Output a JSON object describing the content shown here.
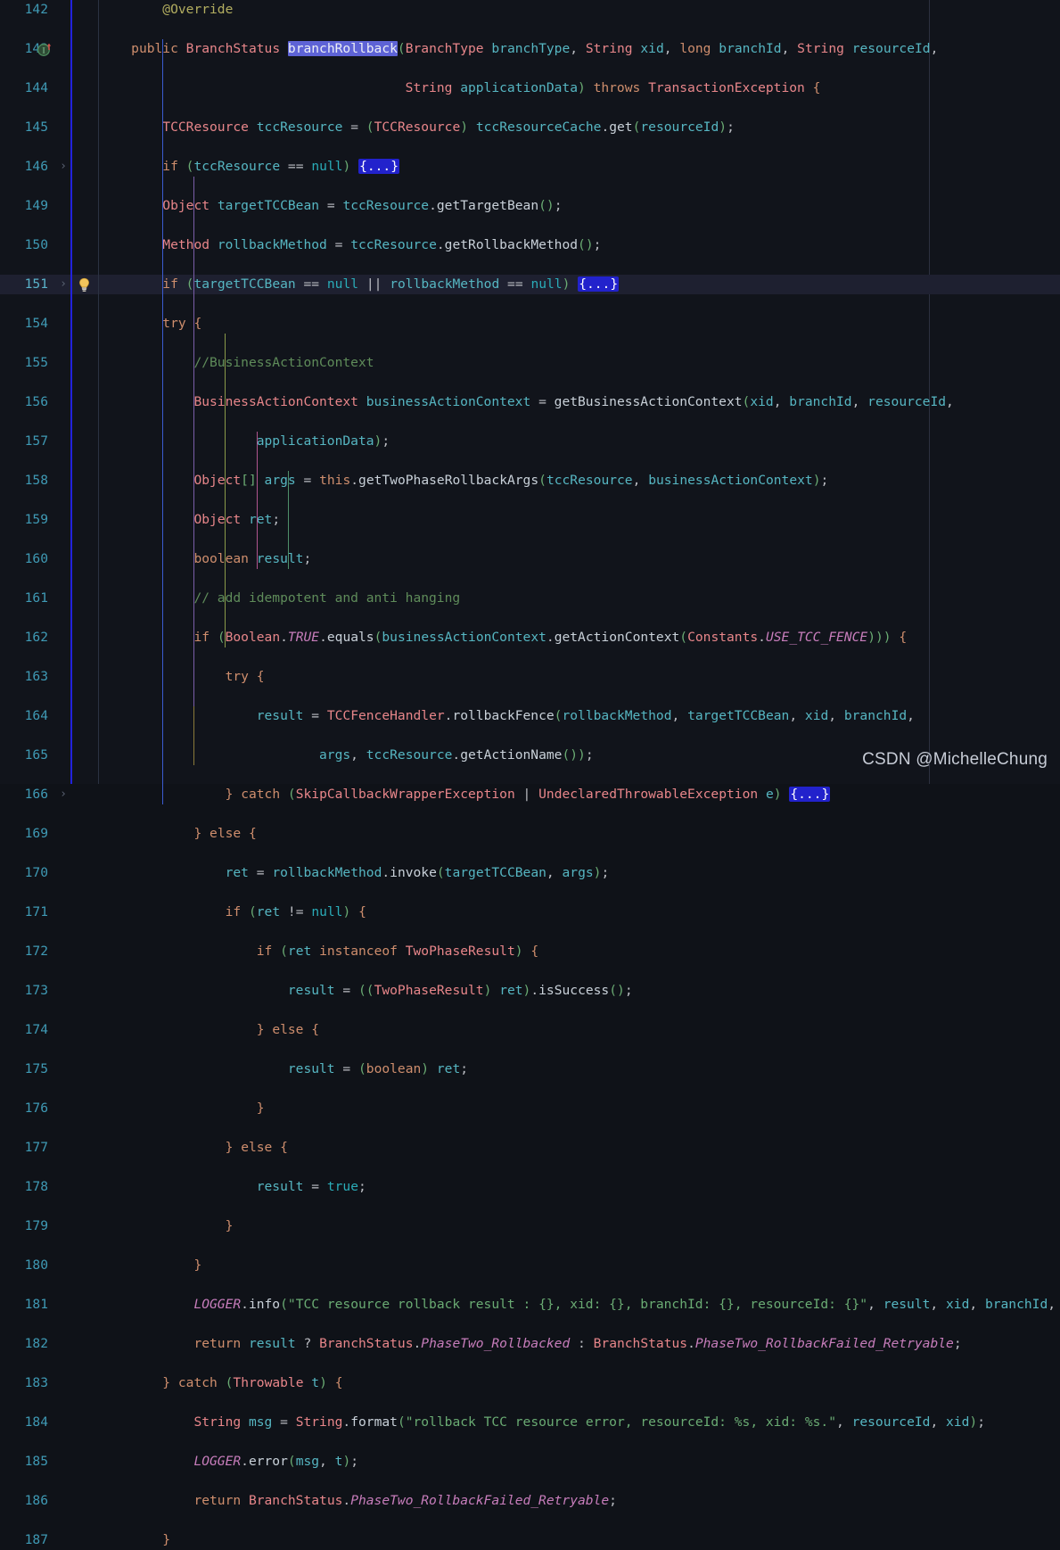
{
  "editor": {
    "theme_background": "#11141b",
    "caret_line_background": "#1e2030",
    "selection_color": "#5e63d6",
    "fold_placeholder_background": "#2222cc",
    "gutter_change_marker_color": "#2222dd",
    "line_number_color": "#3f9ab5",
    "right_margin_ruler_x": 1042,
    "font_size_px": 14.6,
    "line_height_px": 22
  },
  "watermark": {
    "text": "CSDN @MichelleChung"
  },
  "icons": {
    "implementing_method": "implementing-method-icon",
    "intention_bulb": "intention-bulb-icon",
    "fold_arrow": "›",
    "fold_placeholder": "{...}"
  },
  "code": {
    "language": "java",
    "file_kind": "TCCResourceManager.java",
    "lines": [
      {
        "n": "142",
        "fold": false,
        "gutter_icon": null,
        "caret": false,
        "text": "        @Override"
      },
      {
        "n": "143",
        "fold": false,
        "gutter_icon": "implementing-method-icon",
        "caret": false,
        "text": "    public BranchStatus branchRollback(BranchType branchType, String xid, long branchId, String resourceId,"
      },
      {
        "n": "144",
        "fold": false,
        "gutter_icon": null,
        "caret": false,
        "text": "                                       String applicationData) throws TransactionException {"
      },
      {
        "n": "145",
        "fold": false,
        "gutter_icon": null,
        "caret": false,
        "text": "        TCCResource tccResource = (TCCResource) tccResourceCache.get(resourceId);"
      },
      {
        "n": "146",
        "fold": true,
        "gutter_icon": null,
        "caret": false,
        "text": "        if (tccResource == null) {...}"
      },
      {
        "n": "149",
        "fold": false,
        "gutter_icon": null,
        "caret": false,
        "text": "        Object targetTCCBean = tccResource.getTargetBean();"
      },
      {
        "n": "150",
        "fold": false,
        "gutter_icon": null,
        "caret": false,
        "text": "        Method rollbackMethod = tccResource.getRollbackMethod();"
      },
      {
        "n": "151",
        "fold": true,
        "gutter_icon": "intention-bulb-icon",
        "caret": true,
        "text": "        if (targetTCCBean == null || rollbackMethod == null) {...}"
      },
      {
        "n": "154",
        "fold": false,
        "gutter_icon": null,
        "caret": false,
        "text": "        try {"
      },
      {
        "n": "155",
        "fold": false,
        "gutter_icon": null,
        "caret": false,
        "text": "            //BusinessActionContext"
      },
      {
        "n": "156",
        "fold": false,
        "gutter_icon": null,
        "caret": false,
        "text": "            BusinessActionContext businessActionContext = getBusinessActionContext(xid, branchId, resourceId,"
      },
      {
        "n": "157",
        "fold": false,
        "gutter_icon": null,
        "caret": false,
        "text": "                    applicationData);"
      },
      {
        "n": "158",
        "fold": false,
        "gutter_icon": null,
        "caret": false,
        "text": "            Object[] args = this.getTwoPhaseRollbackArgs(tccResource, businessActionContext);"
      },
      {
        "n": "159",
        "fold": false,
        "gutter_icon": null,
        "caret": false,
        "text": "            Object ret;"
      },
      {
        "n": "160",
        "fold": false,
        "gutter_icon": null,
        "caret": false,
        "text": "            boolean result;"
      },
      {
        "n": "161",
        "fold": false,
        "gutter_icon": null,
        "caret": false,
        "text": "            // add idempotent and anti hanging"
      },
      {
        "n": "162",
        "fold": false,
        "gutter_icon": null,
        "caret": false,
        "text": "            if (Boolean.TRUE.equals(businessActionContext.getActionContext(Constants.USE_TCC_FENCE))) {"
      },
      {
        "n": "163",
        "fold": false,
        "gutter_icon": null,
        "caret": false,
        "text": "                try {"
      },
      {
        "n": "164",
        "fold": false,
        "gutter_icon": null,
        "caret": false,
        "text": "                    result = TCCFenceHandler.rollbackFence(rollbackMethod, targetTCCBean, xid, branchId,"
      },
      {
        "n": "165",
        "fold": false,
        "gutter_icon": null,
        "caret": false,
        "text": "                            args, tccResource.getActionName());"
      },
      {
        "n": "166",
        "fold": true,
        "gutter_icon": null,
        "caret": false,
        "text": "                } catch (SkipCallbackWrapperException | UndeclaredThrowableException e) {...}"
      },
      {
        "n": "169",
        "fold": false,
        "gutter_icon": null,
        "caret": false,
        "text": "            } else {"
      },
      {
        "n": "170",
        "fold": false,
        "gutter_icon": null,
        "caret": false,
        "text": "                ret = rollbackMethod.invoke(targetTCCBean, args);"
      },
      {
        "n": "171",
        "fold": false,
        "gutter_icon": null,
        "caret": false,
        "text": "                if (ret != null) {"
      },
      {
        "n": "172",
        "fold": false,
        "gutter_icon": null,
        "caret": false,
        "text": "                    if (ret instanceof TwoPhaseResult) {"
      },
      {
        "n": "173",
        "fold": false,
        "gutter_icon": null,
        "caret": false,
        "text": "                        result = ((TwoPhaseResult) ret).isSuccess();"
      },
      {
        "n": "174",
        "fold": false,
        "gutter_icon": null,
        "caret": false,
        "text": "                    } else {"
      },
      {
        "n": "175",
        "fold": false,
        "gutter_icon": null,
        "caret": false,
        "text": "                        result = (boolean) ret;"
      },
      {
        "n": "176",
        "fold": false,
        "gutter_icon": null,
        "caret": false,
        "text": "                    }"
      },
      {
        "n": "177",
        "fold": false,
        "gutter_icon": null,
        "caret": false,
        "text": "                } else {"
      },
      {
        "n": "178",
        "fold": false,
        "gutter_icon": null,
        "caret": false,
        "text": "                    result = true;"
      },
      {
        "n": "179",
        "fold": false,
        "gutter_icon": null,
        "caret": false,
        "text": "                }"
      },
      {
        "n": "180",
        "fold": false,
        "gutter_icon": null,
        "caret": false,
        "text": "            }"
      },
      {
        "n": "181",
        "fold": false,
        "gutter_icon": null,
        "caret": false,
        "text": "            LOGGER.info(\"TCC resource rollback result : {}, xid: {}, branchId: {}, resourceId: {}\", result, xid, branchId, resourceId);"
      },
      {
        "n": "182",
        "fold": false,
        "gutter_icon": null,
        "caret": false,
        "text": "            return result ? BranchStatus.PhaseTwo_Rollbacked : BranchStatus.PhaseTwo_RollbackFailed_Retryable;"
      },
      {
        "n": "183",
        "fold": false,
        "gutter_icon": null,
        "caret": false,
        "text": "        } catch (Throwable t) {"
      },
      {
        "n": "184",
        "fold": false,
        "gutter_icon": null,
        "caret": false,
        "text": "            String msg = String.format(\"rollback TCC resource error, resourceId: %s, xid: %s.\", resourceId, xid);"
      },
      {
        "n": "185",
        "fold": false,
        "gutter_icon": null,
        "caret": false,
        "text": "            LOGGER.error(msg, t);"
      },
      {
        "n": "186",
        "fold": false,
        "gutter_icon": null,
        "caret": false,
        "text": "            return BranchStatus.PhaseTwo_RollbackFailed_Retryable;"
      },
      {
        "n": "187",
        "fold": false,
        "gutter_icon": null,
        "caret": false,
        "text": "        }"
      }
    ],
    "selected_text": "branchRollback"
  }
}
